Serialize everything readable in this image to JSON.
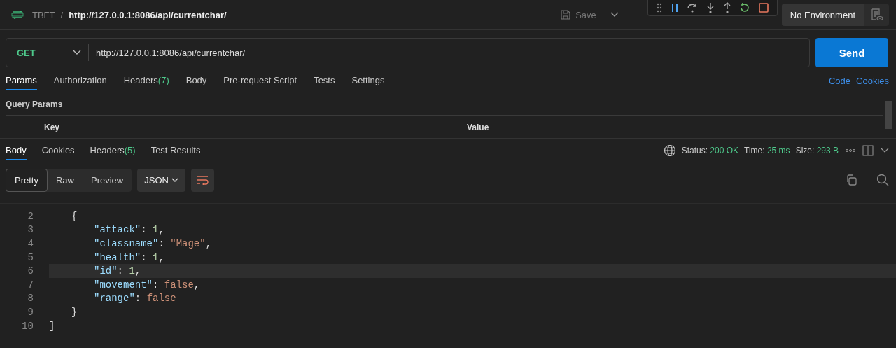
{
  "header": {
    "collection": "TBFT",
    "separator": "/",
    "title": "http://127.0.0.1:8086/api/currentchar/",
    "save": "Save",
    "environment": "No Environment"
  },
  "request": {
    "method": "GET",
    "url": "http://127.0.0.1:8086/api/currentchar/",
    "send": "Send"
  },
  "request_tabs": [
    {
      "label": "Params",
      "selected": true
    },
    {
      "label": "Authorization",
      "selected": false
    },
    {
      "label": "Headers",
      "count": "(7)",
      "selected": false
    },
    {
      "label": "Body",
      "selected": false
    },
    {
      "label": "Pre-request Script",
      "selected": false
    },
    {
      "label": "Tests",
      "selected": false
    },
    {
      "label": "Settings",
      "selected": false
    }
  ],
  "request_links": [
    "Code",
    "Cookies"
  ],
  "query_params": {
    "title": "Query Params",
    "columns": [
      "Key",
      "Value"
    ]
  },
  "response_tabs": [
    {
      "label": "Body",
      "selected": true
    },
    {
      "label": "Cookies",
      "selected": false
    },
    {
      "label": "Headers",
      "count": "(5)",
      "selected": false
    },
    {
      "label": "Test Results",
      "selected": false
    }
  ],
  "response_meta": [
    {
      "label": "Status:",
      "value": "200 OK"
    },
    {
      "label": "Time:",
      "value": "25 ms"
    },
    {
      "label": "Size:",
      "value": "293 B"
    }
  ],
  "view_modes": [
    {
      "label": "Pretty",
      "selected": true
    },
    {
      "label": "Raw",
      "selected": false
    },
    {
      "label": "Preview",
      "selected": false
    }
  ],
  "format": "JSON",
  "code_lines": [
    {
      "number": "2",
      "current": false,
      "tokens": [
        {
          "kind": "indent1"
        },
        {
          "kind": "punct",
          "text": "{"
        }
      ]
    },
    {
      "number": "3",
      "current": false,
      "tokens": [
        {
          "kind": "indent2"
        },
        {
          "kind": "key",
          "text": "\"attack\""
        },
        {
          "kind": "punct",
          "text": ": "
        },
        {
          "kind": "number",
          "text": "1"
        },
        {
          "kind": "punct",
          "text": ","
        }
      ]
    },
    {
      "number": "4",
      "current": false,
      "tokens": [
        {
          "kind": "indent2"
        },
        {
          "kind": "key",
          "text": "\"classname\""
        },
        {
          "kind": "punct",
          "text": ": "
        },
        {
          "kind": "string",
          "text": "\"Mage\""
        },
        {
          "kind": "punct",
          "text": ","
        }
      ]
    },
    {
      "number": "5",
      "current": false,
      "tokens": [
        {
          "kind": "indent2"
        },
        {
          "kind": "key",
          "text": "\"health\""
        },
        {
          "kind": "punct",
          "text": ": "
        },
        {
          "kind": "number",
          "text": "1"
        },
        {
          "kind": "punct",
          "text": ","
        }
      ]
    },
    {
      "number": "6",
      "current": true,
      "tokens": [
        {
          "kind": "indent2"
        },
        {
          "kind": "key",
          "text": "\"id\""
        },
        {
          "kind": "punct",
          "text": ": "
        },
        {
          "kind": "number",
          "text": "1"
        },
        {
          "kind": "punct",
          "text": ","
        }
      ]
    },
    {
      "number": "7",
      "current": false,
      "tokens": [
        {
          "kind": "indent2"
        },
        {
          "kind": "key",
          "text": "\"movement\""
        },
        {
          "kind": "punct",
          "text": ": "
        },
        {
          "kind": "bool",
          "text": "false"
        },
        {
          "kind": "punct",
          "text": ","
        }
      ]
    },
    {
      "number": "8",
      "current": false,
      "tokens": [
        {
          "kind": "indent2"
        },
        {
          "kind": "key",
          "text": "\"range\""
        },
        {
          "kind": "punct",
          "text": ": "
        },
        {
          "kind": "bool",
          "text": "false"
        }
      ]
    },
    {
      "number": "9",
      "current": false,
      "tokens": [
        {
          "kind": "indent1"
        },
        {
          "kind": "punct",
          "text": "}"
        }
      ]
    },
    {
      "number": "10",
      "current": false,
      "tokens": [
        {
          "kind": "punct",
          "text": "]"
        }
      ]
    }
  ]
}
